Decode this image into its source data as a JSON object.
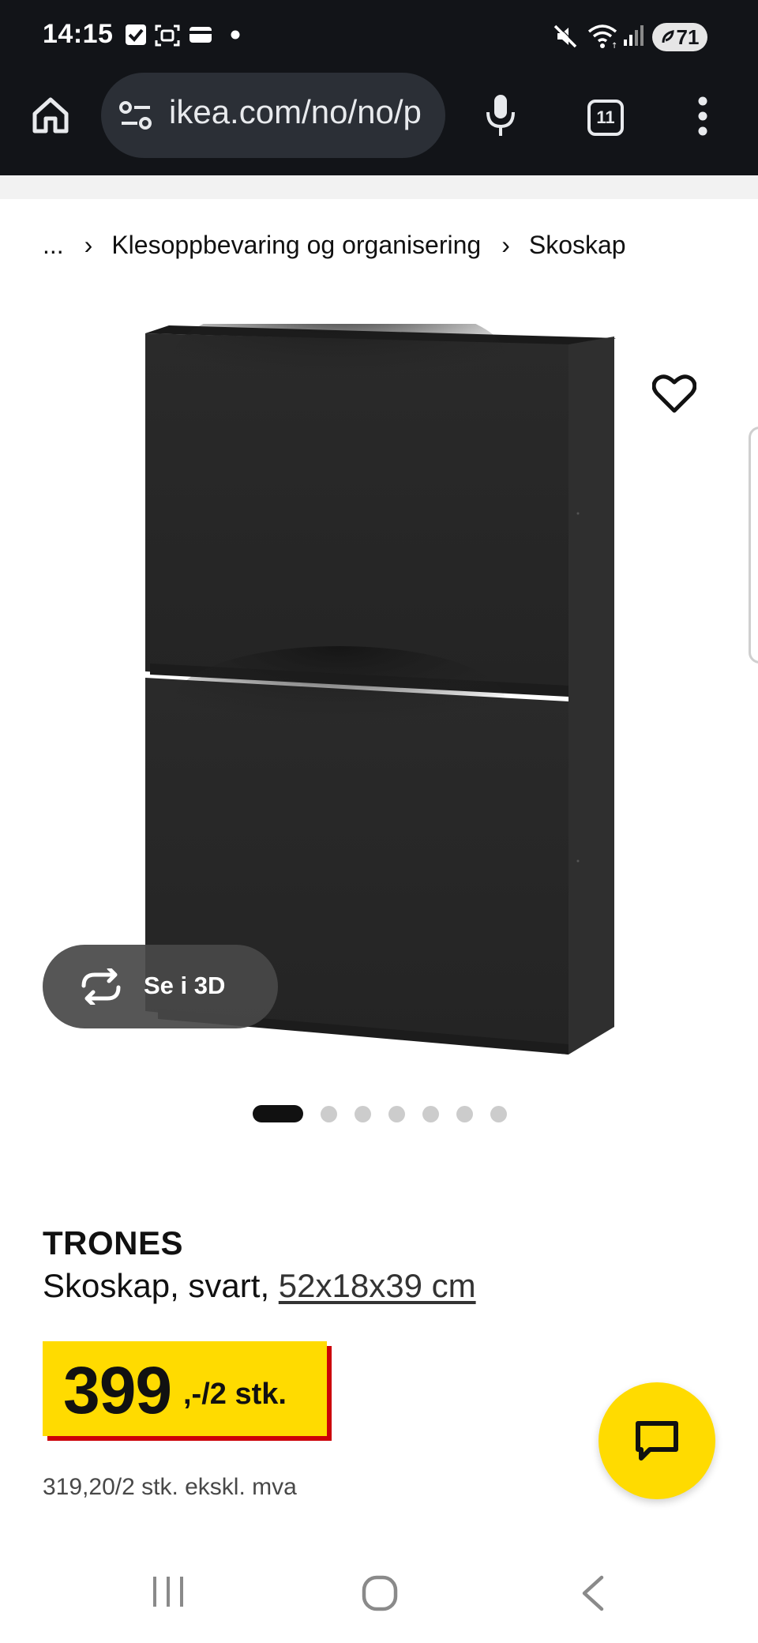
{
  "status_bar": {
    "time": "14:15",
    "battery_level": "71",
    "icons": [
      "checkbox-notification-icon",
      "screenshot-icon",
      "wallet-icon",
      "dot-icon",
      "mute-icon",
      "wifi-icon",
      "signal-icon"
    ]
  },
  "browser": {
    "url": "ikea.com/no/no/p",
    "tab_count": "11",
    "icons": [
      "home-icon",
      "site-settings-icon",
      "mic-icon",
      "tabs-icon",
      "more-icon"
    ]
  },
  "breadcrumb": {
    "ellipsis": "...",
    "items": [
      "Klesoppbevaring og organisering",
      "Skoskap"
    ]
  },
  "gallery": {
    "view_3d_label": "Se i 3D",
    "dot_count": 7,
    "active_index": 0
  },
  "product": {
    "name": "TRONES",
    "description": "Skoskap, svart, ",
    "dimensions": "52x18x39 cm",
    "price_main": "399",
    "price_suffix": ",-/2 stk.",
    "price_ex_vat": "319,20/2 stk. ekskl. mva"
  },
  "colors": {
    "price_yellow": "#ffdb00",
    "price_red": "#cc0008",
    "browser_dark": "#121418"
  }
}
